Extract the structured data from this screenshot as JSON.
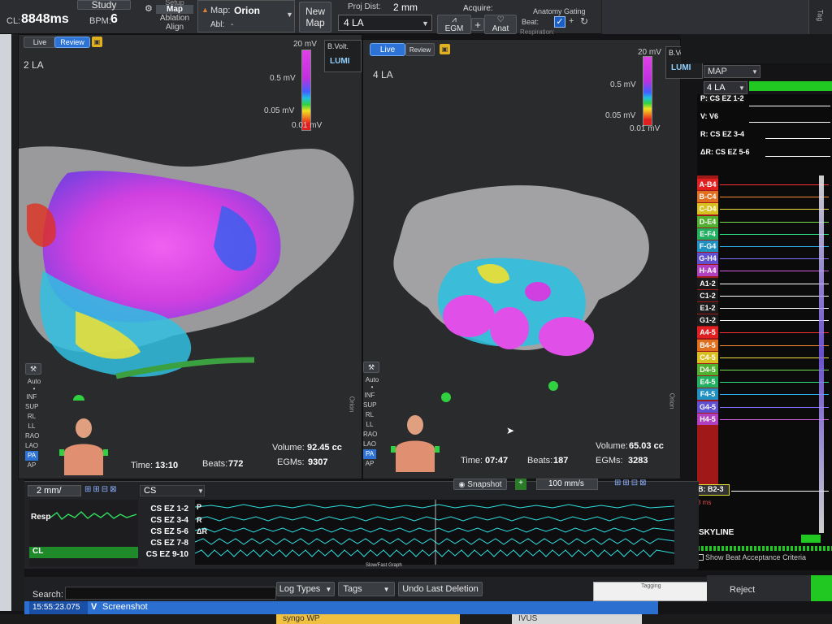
{
  "topbar": {
    "cl_label": "CL:",
    "cl_value": "8848ms",
    "bpm_label": "BPM:",
    "bpm_value": "6",
    "study_label": "Study",
    "setup_label": "Setup",
    "map_label": "Map",
    "ablation_label": "Ablation",
    "align_label": "Align",
    "map_field_label": "Map:",
    "map_field_value": "Orion",
    "abl_label": "Abl:",
    "abl_value": "-",
    "new_map_line1": "New",
    "new_map_line2": "Map",
    "proj_dist_label": "Proj Dist:",
    "proj_dist_value": "2 mm",
    "map_select_value": "4 LA",
    "acquire_label": "Acquire:",
    "egm_label": "EGM",
    "anat_label": "Anat",
    "anatomy_gating_label": "Anatomy Gating",
    "beat_label": "Beat:",
    "respiration_label": "Respiration:",
    "tag_label": "Tag"
  },
  "left_map": {
    "live_label": "Live",
    "review_label": "Review",
    "map_name": "2 LA",
    "bvolt_label": "B.Volt.",
    "lumi_label": "LUMI",
    "scale_top": "20 mV",
    "scale_mid1": "0.5 mV",
    "scale_mid2": "0.05 mV",
    "scale_bottom": "0.01 mV",
    "auto_label": "Auto",
    "views": [
      "INF",
      "SUP",
      "RL",
      "LL",
      "RAO",
      "LAO",
      "PA",
      "AP"
    ],
    "selected_view": "PA",
    "time_label": "Time:",
    "time_value": "13:10",
    "beats_label": "Beats:",
    "beats_value": "772",
    "volume_label": "Volume:",
    "volume_value": "92.45 cc",
    "egms_label": "EGMs:",
    "egms_value": "9307",
    "orion_label": "Orion"
  },
  "right_map": {
    "live_label": "Live",
    "review_label": "Review",
    "map_name": "4 LA",
    "bvolt_label": "B.Volt.",
    "lumi_label": "LUMI",
    "scale_top": "20 mV",
    "scale_mid1": "0.5 mV",
    "scale_mid2": "0.05 mV",
    "scale_bottom": "0.01 mV",
    "auto_label": "Auto",
    "views": [
      "INF",
      "SUP",
      "RL",
      "LL",
      "RAO",
      "LAO",
      "PA",
      "AP"
    ],
    "selected_view": "PA",
    "time_label": "Time:",
    "time_value": "07:47",
    "beats_label": "Beats:",
    "beats_value": "187",
    "volume_label": "Volume:",
    "volume_value": "65.03 cc",
    "egms_label": "EGMs:",
    "egms_value": "3283",
    "orion_label": "Orion"
  },
  "channel_panel": {
    "map_select": "MAP",
    "map_sub": "4 LA",
    "header_channels": [
      {
        "label": "P: CS EZ 1-2"
      },
      {
        "label": "V: V6"
      },
      {
        "label": "R: CS EZ 3-4"
      },
      {
        "label": "ΔR: CS EZ 5-6"
      }
    ],
    "channels": [
      {
        "label": "A-B4",
        "bg": "#e02020",
        "line": "#ff3030"
      },
      {
        "label": "B-C4",
        "bg": "#e07020",
        "line": "#ff8a30"
      },
      {
        "label": "C-D4",
        "bg": "#d8c020",
        "line": "#f0e040"
      },
      {
        "label": "D-E4",
        "bg": "#50b030",
        "line": "#70e050"
      },
      {
        "label": "E-F4",
        "bg": "#20b060",
        "line": "#30e080"
      },
      {
        "label": "F-G4",
        "bg": "#2090c0",
        "line": "#30b0f0"
      },
      {
        "label": "G-H4",
        "bg": "#6050d0",
        "line": "#8070ff"
      },
      {
        "label": "H-A4",
        "bg": "#b040c0",
        "line": "#d060e0"
      },
      {
        "label": "A1-2",
        "bg": "#1a1a1a",
        "line": "#ffffff"
      },
      {
        "label": "C1-2",
        "bg": "#1a1a1a",
        "line": "#ffffff"
      },
      {
        "label": "E1-2",
        "bg": "#1a1a1a",
        "line": "#ffffff"
      },
      {
        "label": "G1-2",
        "bg": "#1a1a1a",
        "line": "#ffffff"
      },
      {
        "label": "A4-5",
        "bg": "#e02020",
        "line": "#ff3030"
      },
      {
        "label": "B4-5",
        "bg": "#e07020",
        "line": "#ff8a30"
      },
      {
        "label": "C4-5",
        "bg": "#d8c020",
        "line": "#f0e040"
      },
      {
        "label": "D4-5",
        "bg": "#50b030",
        "line": "#70e050"
      },
      {
        "label": "E4-5",
        "bg": "#20b060",
        "line": "#30e080"
      },
      {
        "label": "F4-5",
        "bg": "#2090c0",
        "line": "#30b0f0"
      },
      {
        "label": "G4-5",
        "bg": "#6050d0",
        "line": "#8070ff"
      },
      {
        "label": "H4-5",
        "bg": "#b040c0",
        "line": "#d060e0"
      }
    ],
    "b_channel": "B: B2-3",
    "ms_label": "8 ms",
    "skyline_label": "SKYLINE",
    "show_beat_label": "Show Beat Acceptance Criteria"
  },
  "egm_strip": {
    "speed_left": "2 mm/",
    "cs_label": "CS",
    "snapshot_label": "Snapshot",
    "speed_right": "100 mm/s",
    "resp_label": "Resp",
    "cl_label": "CL",
    "channels": [
      "CS EZ 1-2",
      "CS EZ 3-4",
      "CS EZ 5-6",
      "CS EZ 7-8",
      "CS EZ 9-10"
    ],
    "markers": [
      "P",
      "R",
      "ΔR"
    ],
    "slowfast_label": "Slow/Fast Graph"
  },
  "bottom": {
    "search_label": "Search:",
    "log_types_label": "Log Types",
    "tags_label": "Tags",
    "undo_label": "Undo Last Deletion",
    "tagging_label": "Tagging",
    "reject_label": "Reject",
    "timestamp": "15:55:23.075",
    "v_label": "V",
    "screenshot_label": "Screenshot",
    "syngo_label": "syngo WP",
    "ivus_label": "IVUS"
  },
  "colors": {
    "accent_blue": "#2d73d6",
    "status_green": "#22c822",
    "map_magenta": "#e040e8",
    "egm_cyan": "#30e0e0"
  }
}
